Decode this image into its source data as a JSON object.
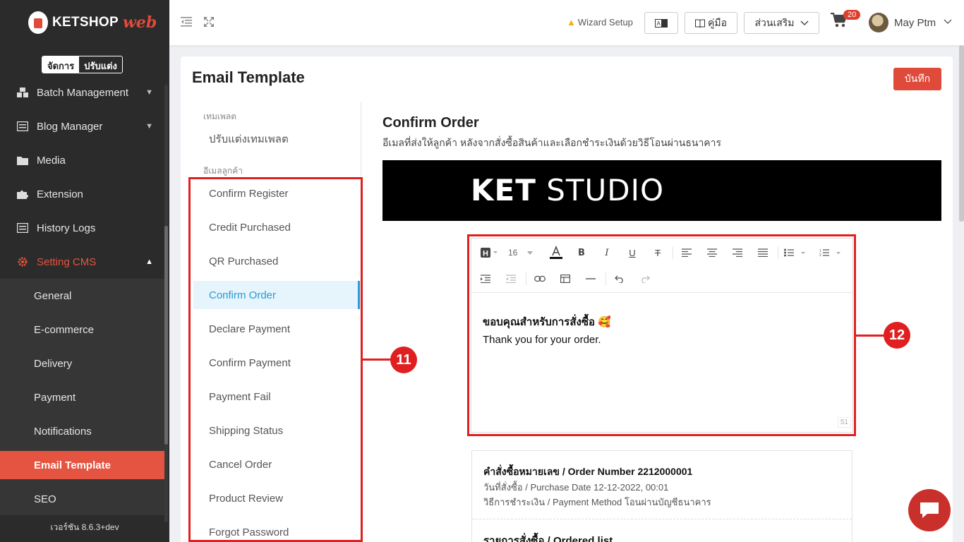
{
  "app": {
    "logo_main": "KETSHOP",
    "logo_script": "web"
  },
  "mode_toggle": {
    "manage": "จัดการ",
    "customize": "ปรับแต่ง"
  },
  "sidebar": {
    "items": [
      {
        "label": "Batch Management",
        "icon": "batch-icon"
      },
      {
        "label": "Blog Manager",
        "icon": "blog-icon"
      },
      {
        "label": "Media",
        "icon": "folder-icon"
      },
      {
        "label": "Extension",
        "icon": "puzzle-icon"
      },
      {
        "label": "History Logs",
        "icon": "list-icon"
      },
      {
        "label": "Setting CMS",
        "icon": "gear-icon"
      }
    ],
    "sub_items": [
      "General",
      "E-commerce",
      "Delivery",
      "Payment",
      "Notifications",
      "Email Template",
      "SEO"
    ],
    "active_sub": "Email Template",
    "version": "เวอร์ชัน 8.6.3+dev"
  },
  "topbar": {
    "wizard": "Wizard Setup",
    "manual": "คู่มือ",
    "addons": "ส่วนเสริม",
    "cart_count": "20",
    "user_name": "May Ptm"
  },
  "page": {
    "title": "Email Template",
    "save": "บันทึก"
  },
  "template_menu": {
    "section_template": "เทมเพลต",
    "customize_template": "ปรับแต่งเทมเพลต",
    "section_customer": "อีเมลลูกค้า",
    "items": [
      "Confirm Register",
      "Credit Purchased",
      "QR Purchased",
      "Confirm Order",
      "Declare Payment",
      "Confirm Payment",
      "Payment Fail",
      "Shipping Status",
      "Cancel Order",
      "Product Review",
      "Forgot Password"
    ],
    "active": "Confirm Order"
  },
  "detail": {
    "title": "Confirm Order",
    "description": "อีเมลที่ส่งให้ลูกค้า หลังจากสั่งซื้อสินค้าและเลือกชำระเงินด้วยวิธีโอนผ่านธนาคาร",
    "banner_bold": "KET",
    "banner_light": " STUDIO",
    "font_size": "16",
    "body_line1": "ขอบคุณสำหรับการสั่งซื้อ 🥰",
    "body_line2": "Thank you for your order.",
    "char_count": "51"
  },
  "order": {
    "number": "คำสั่งซื้อหมายเลข / Order Number 2212000001",
    "date": "วันที่สั่งซื้อ / Purchase Date 12-12-2022, 00:01",
    "method": "วิธีการชำระเงิน / Payment Method โอนผ่านบัญชีธนาคาร",
    "list_title": "รายการสั่งซื้อ / Ordered list"
  },
  "callouts": {
    "menu": "11",
    "editor": "12"
  },
  "colors": {
    "accent": "#e04a3a",
    "active_link": "#2a9bd7",
    "sidebar": "#2b2b2b",
    "highlight": "#e02020"
  }
}
